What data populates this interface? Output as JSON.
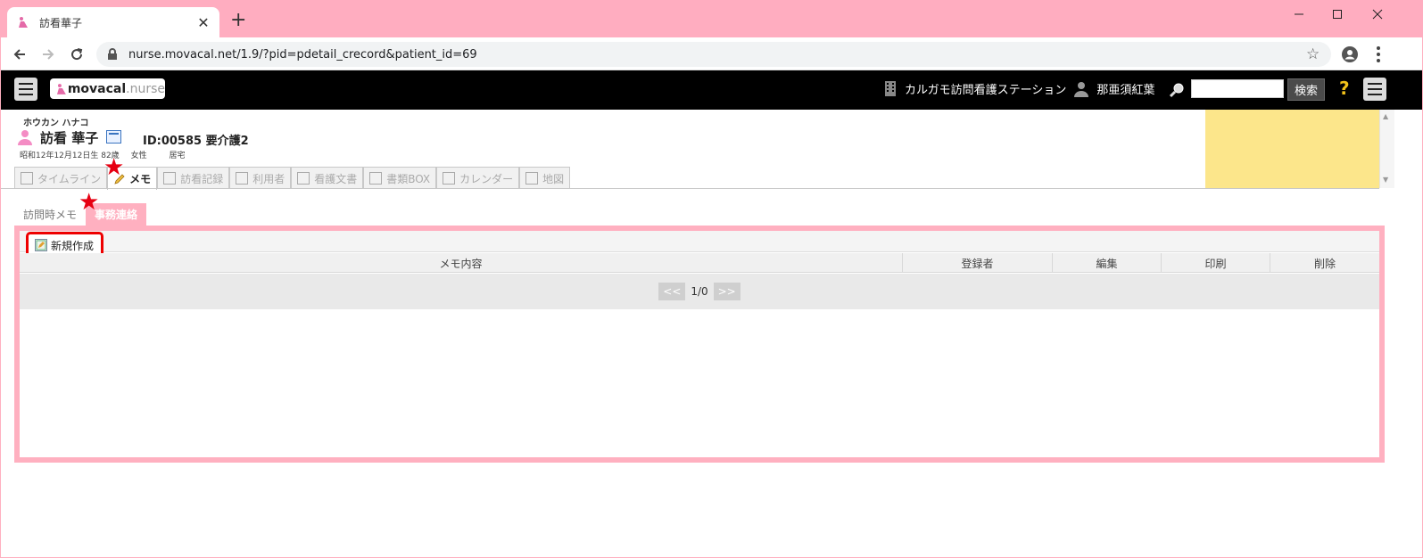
{
  "browser": {
    "tab_title": "訪看華子",
    "new_tab_symbol": "+",
    "close_symbol": "✕",
    "url": "nurse.movacal.net/1.9/?pid=pdetail_crecord&patient_id=69"
  },
  "appbar": {
    "logo_main": "movacal",
    "logo_sub": ".nurse",
    "station_name": "カルガモ訪問看護ステーション",
    "user_name": "那亜須紅葉",
    "search_value": "",
    "search_button": "検索",
    "help_symbol": "?"
  },
  "patient": {
    "furigana": "ホウカン ハナコ",
    "name": "訪看 華子",
    "id_care": "ID:00585 要介護2",
    "birth": "昭和12年12月12日生",
    "age": "82歳",
    "sex": "女性",
    "residence": "居宅"
  },
  "tabs": [
    {
      "label": "タイムライン"
    },
    {
      "label": "メモ"
    },
    {
      "label": "訪看記録"
    },
    {
      "label": "利用者"
    },
    {
      "label": "看護文書"
    },
    {
      "label": "書類BOX"
    },
    {
      "label": "カレンダー"
    },
    {
      "label": "地図"
    }
  ],
  "subtabs": [
    {
      "label": "訪問時メモ"
    },
    {
      "label": "事務連絡"
    }
  ],
  "memo": {
    "new_button": "新規作成",
    "columns": [
      "メモ内容",
      "登録者",
      "編集",
      "印刷",
      "削除"
    ],
    "pager_prev": "<<",
    "pager_info": "1/0",
    "pager_next": ">>"
  },
  "colors": {
    "accent_pink": "#ffb0c0",
    "chrome_pink": "#ffadc0",
    "highlight_red": "#e00000",
    "note_yellow": "#fce68b"
  }
}
